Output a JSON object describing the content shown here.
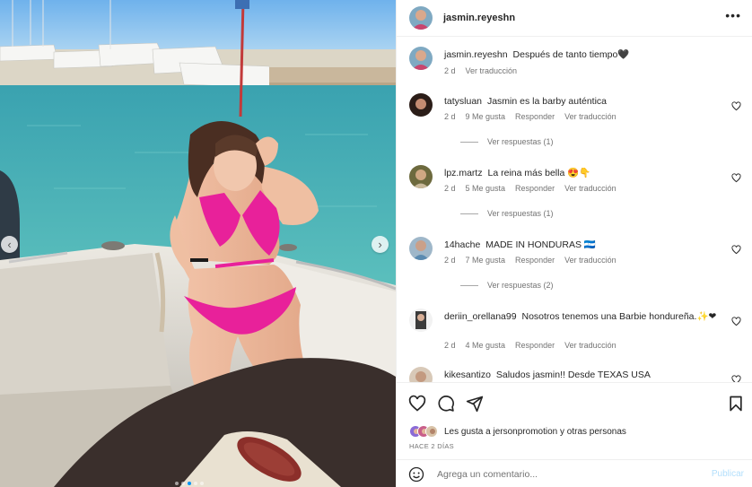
{
  "post": {
    "username": "jasmin.reyeshn",
    "more_icon": "more-horizontal-icon",
    "caption": {
      "username": "jasmin.reyeshn",
      "text": "Después de tanto tiempo🖤",
      "time": "2 d",
      "translate": "Ver traducción"
    },
    "carousel": {
      "slides": 5,
      "active_slide": 3,
      "prev_icon": "chevron-left-icon",
      "next_icon": "chevron-right-icon"
    }
  },
  "comments": [
    {
      "username": "tatysluan",
      "text": "Jasmin es la barby auténtica",
      "time": "2 d",
      "likes": "9 Me gusta",
      "reply": "Responder",
      "translate": "Ver traducción",
      "replies": "Ver respuestas (1)"
    },
    {
      "username": "lpz.martz",
      "text": "La reina más bella 😍👇",
      "time": "2 d",
      "likes": "5 Me gusta",
      "reply": "Responder",
      "translate": "Ver traducción",
      "replies": "Ver respuestas (1)"
    },
    {
      "username": "14hache",
      "text": "MADE IN HONDURAS 🇭🇳",
      "time": "2 d",
      "likes": "7 Me gusta",
      "reply": "Responder",
      "translate": "Ver traducción",
      "replies": "Ver respuestas (2)"
    },
    {
      "username": "deriin_orellana99",
      "text": "Nosotros tenemos una Barbie hondureña.✨❤",
      "time": "2 d",
      "likes": "4 Me gusta",
      "reply": "Responder",
      "translate": "Ver traducción"
    },
    {
      "username": "kikesantizo",
      "text": "Saludos jasmin!! Desde TEXAS USA"
    }
  ],
  "actions": {
    "like_icon": "heart-icon",
    "comment_icon": "comment-icon",
    "share_icon": "send-icon",
    "save_icon": "bookmark-icon",
    "likes_prefix": "Les gusta a",
    "likes_user": "jersonpromotion",
    "likes_joiner": "y",
    "likes_others": "otras personas",
    "time_ago": "HACE 2 DÍAS"
  },
  "add_comment": {
    "emoji_icon": "smiley-icon",
    "placeholder": "Agrega un comentario...",
    "publish": "Publicar"
  },
  "colors": {
    "link_blue": "#0095f6",
    "publish_disabled": "#b2dffc",
    "muted_text": "#737373",
    "divider": "#efefef",
    "bikini_pink": "#e8219a"
  }
}
